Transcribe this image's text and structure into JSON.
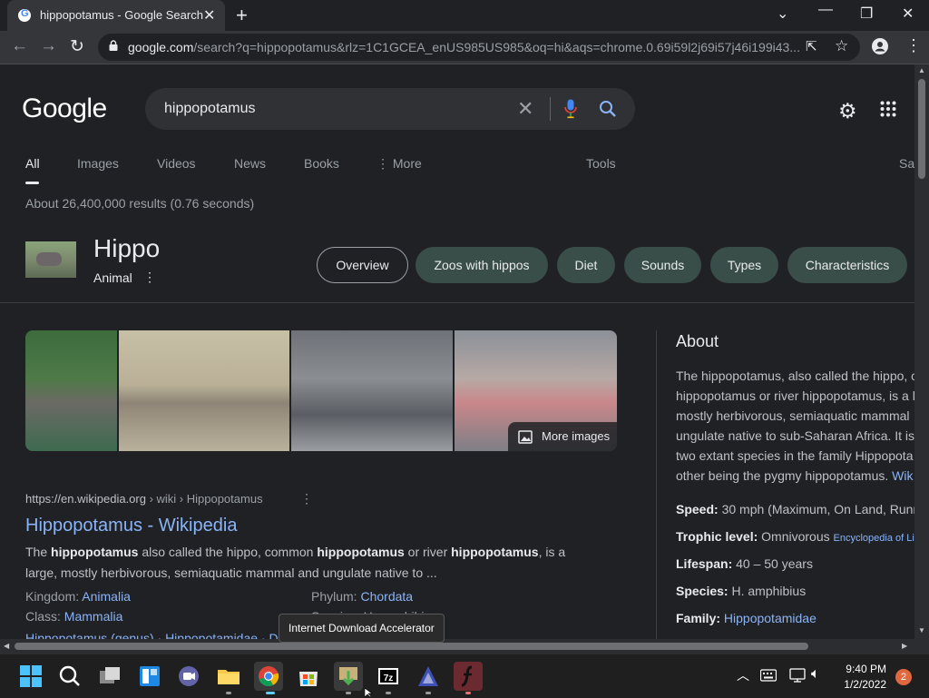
{
  "browser": {
    "tab_title": "hippopotamus - Google Search",
    "url_domain": "google.com",
    "url_rest": "/search?q=hippopotamus&rlz=1C1GCEA_enUS985US985&oq=hi&aqs=chrome.0.69i59l2j69i57j46i199i43..."
  },
  "search": {
    "logo": "Google",
    "query": "hippopotamus",
    "tabs": [
      "All",
      "Images",
      "Videos",
      "News",
      "Books",
      "⋮ More"
    ],
    "tools": "Tools",
    "safe": "Sa",
    "stats": "About 26,400,000 results (0.76 seconds)"
  },
  "knowledge": {
    "title": "Hippo",
    "subtitle": "Animal",
    "chips": [
      "Overview",
      "Zoos with hippos",
      "Diet",
      "Sounds",
      "Types",
      "Characteristics"
    ],
    "more_images": "More images",
    "about_heading": "About",
    "about_lines": [
      "The hippopotamus, also called the hippo, c",
      "hippopotamus or river hippopotamus, is a l",
      "mostly herbivorous, semiaquatic mammal",
      "ungulate native to sub-Saharan Africa. It is",
      "two extant species in the family Hippopota",
      "other being the pygmy hippopotamus."
    ],
    "about_link": "Wik",
    "facts": [
      {
        "label": "Speed:",
        "value": "30 mph (Maximum, On Land, Runn"
      },
      {
        "label": "Trophic level:",
        "value": "Omnivorous",
        "source": "Encyclopedia of Life"
      },
      {
        "label": "Lifespan:",
        "value": "40 – 50 years"
      },
      {
        "label": "Species:",
        "value": "H. amphibius"
      },
      {
        "label": "Family:",
        "value": "Hippopotamidae",
        "is_link": true
      }
    ]
  },
  "result": {
    "url": "https://en.wikipedia.org",
    "url_path": " › wiki › Hippopotamus",
    "title": "Hippopotamus - Wikipedia",
    "snippet_parts": [
      "The ",
      "hippopotamus",
      " also called the hippo, common ",
      "hippopotamus",
      " or river ",
      "hippopotamus",
      ", is a",
      "large, mostly herbivorous, semiaquatic mammal and ungulate native to ..."
    ],
    "kingdom_label": "Kingdom:",
    "kingdom": "Animalia",
    "phylum_label": "Phylum:",
    "phylum": "Chordata",
    "class_label": "Class:",
    "class": "Mammalia",
    "species_label": "Species:",
    "species": "H. amphibius",
    "cut_line": "Hippopotamus (genus) · Hippopotamidae · D"
  },
  "tooltip": "Internet Download Accelerator",
  "taskbar": {
    "time": "9:40 PM",
    "date": "1/2/2022",
    "notifications": "2"
  },
  "colors": {
    "background": "#202124",
    "link": "#8ab4f8",
    "chip": "#394e48",
    "notification": "#e0683f"
  }
}
